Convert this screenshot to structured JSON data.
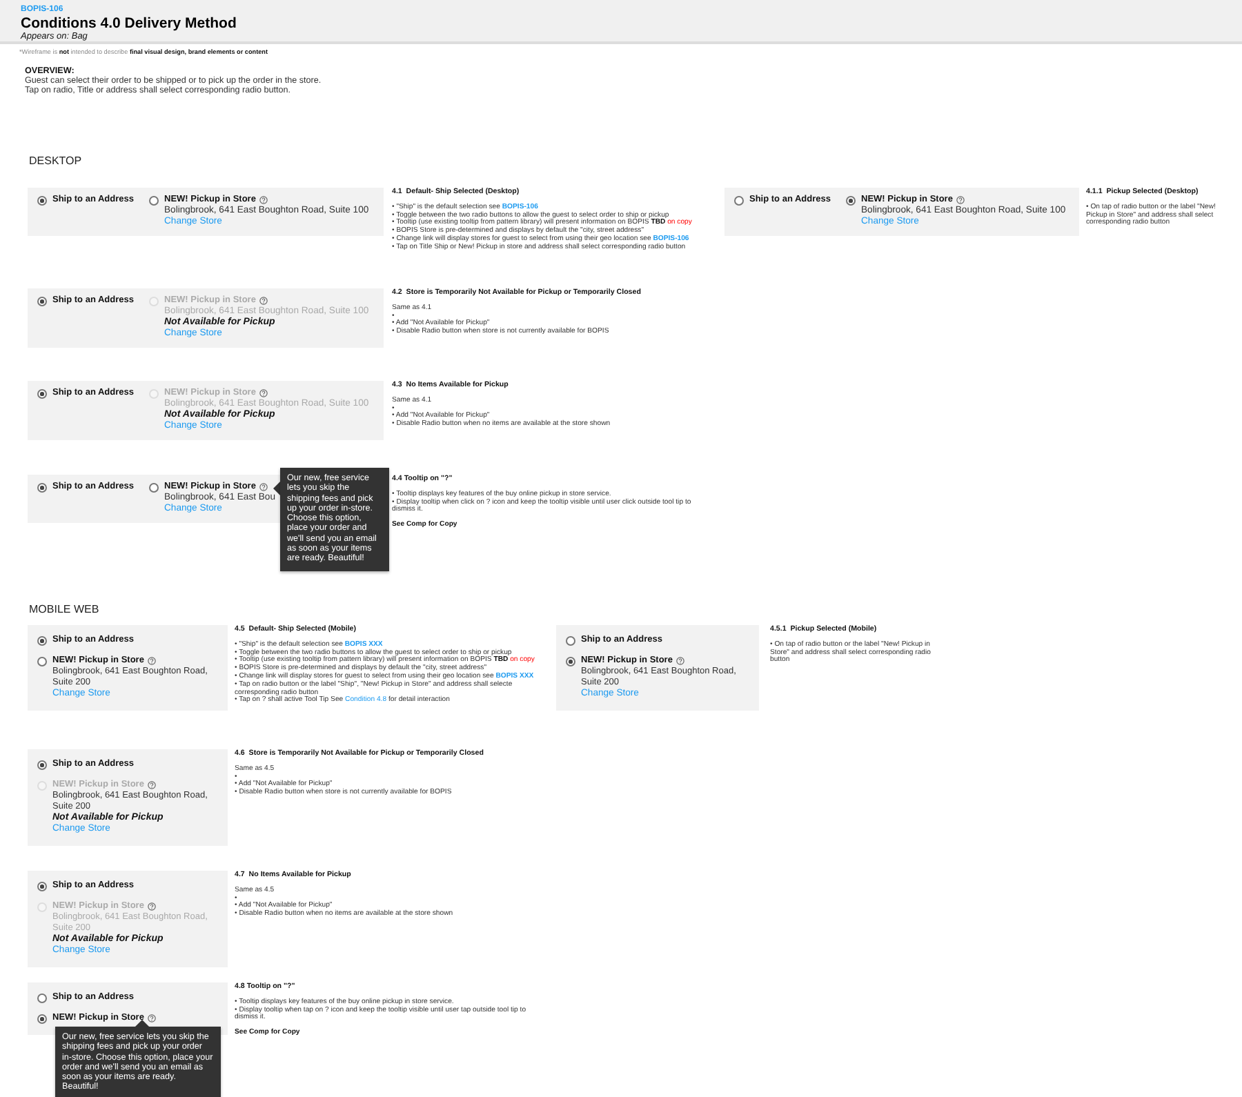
{
  "header": {
    "ticket": "BOPIS-106",
    "title": "Conditions 4.0 Delivery Method",
    "appears_on": "Appears on: Bag"
  },
  "disclaimer": [
    {
      "text": "*Wireframe is ",
      "kind": "muted"
    },
    {
      "text": "not",
      "kind": "alert-strong"
    },
    {
      "text": " intended to describe ",
      "kind": "muted"
    },
    {
      "text": "final visual design, brand elements or content",
      "kind": "strong"
    }
  ],
  "overview": {
    "heading": "OVERVIEW:",
    "lines": [
      "Guest can select their order to be shipped or to pick up the order in the store.",
      "Tap on radio, Title or address shall select corresponding radio button."
    ]
  },
  "sections": [
    {
      "heading": "DESKTOP",
      "kind": "desktop",
      "rows": [
        {
          "items": [
            {
              "kind": "card",
              "ship": {
                "label": "Ship to an Address",
                "selected": true
              },
              "pickup": {
                "label": "NEW! Pickup in Store",
                "selected": false,
                "disabled": false,
                "address": "Bolingbrook, 641 East Boughton Road, Suite 100",
                "address_disabled": false,
                "link": "Change Store"
              }
            },
            {
              "kind": "note",
              "title": "4.1  Default- Ship Selected (Desktop)",
              "lines": [
                {
                  "kind": "text",
                  "parts": [
                    {
                      "text": "• \"Ship\" is the default selection see ",
                      "kind": "plain"
                    },
                    {
                      "text": "BOPIS-106",
                      "kind": "ref"
                    }
                  ]
                },
                {
                  "kind": "text",
                  "parts": [
                    {
                      "text": "• Toggle between the two radio buttons to allow the guest to select order to ship or pickup",
                      "kind": "plain"
                    }
                  ]
                },
                {
                  "kind": "text",
                  "parts": [
                    {
                      "text": "• Tooltip (use existing tooltip from pattern library) will present information on BOPIS ",
                      "kind": "plain"
                    },
                    {
                      "text": "TBD",
                      "kind": "alert-strong"
                    },
                    {
                      "text": " on copy",
                      "kind": "alert"
                    }
                  ]
                },
                {
                  "kind": "text",
                  "parts": [
                    {
                      "text": "• BOPIS Store is pre-determined and displays by default the \"city, street address\"",
                      "kind": "plain"
                    }
                  ]
                },
                {
                  "kind": "text",
                  "parts": [
                    {
                      "text": "• Change link will display stores for guest to select from using their geo location see ",
                      "kind": "plain"
                    },
                    {
                      "text": "BOPIS-106",
                      "kind": "ref"
                    }
                  ]
                },
                {
                  "kind": "text",
                  "parts": [
                    {
                      "text": "• Tap on Title Ship or New! Pickup in store and address shall select corresponding radio button",
                      "kind": "plain"
                    }
                  ]
                }
              ]
            },
            {
              "kind": "card",
              "ship": {
                "label": "Ship to an Address",
                "selected": false
              },
              "pickup": {
                "label": "NEW! Pickup in Store",
                "selected": true,
                "disabled": false,
                "address": "Bolingbrook, 641 East Boughton Road, Suite 100",
                "address_disabled": false,
                "link": "Change Store"
              }
            },
            {
              "kind": "note",
              "title": "4.1.1  Pickup Selected (Desktop)",
              "lines": [
                {
                  "kind": "text",
                  "parts": [
                    {
                      "text": "• On tap of radio button or the label \"New! Pickup in Store\" and address shall select corresponding radio button",
                      "kind": "plain"
                    }
                  ]
                }
              ]
            }
          ]
        },
        {
          "items": [
            {
              "kind": "card",
              "ship": {
                "label": "Ship to an Address",
                "selected": true
              },
              "pickup": {
                "label": "NEW! Pickup in Store",
                "selected": false,
                "disabled": true,
                "address": "Bolingbrook, 641 East Boughton Road, Suite 100",
                "address_disabled": true,
                "unavailable": "Not Available for Pickup",
                "link": "Change Store"
              }
            },
            {
              "kind": "note",
              "title": "4.2  Store is Temporarily Not Available for Pickup or Temporarily Closed",
              "lines": [
                {
                  "kind": "text",
                  "parts": [
                    {
                      "text": "Same as 4.1",
                      "kind": "plain"
                    }
                  ]
                },
                {
                  "kind": "text",
                  "parts": [
                    {
                      "text": "•",
                      "kind": "plain"
                    }
                  ]
                },
                {
                  "kind": "text",
                  "parts": [
                    {
                      "text": "• Add \"Not Available for Pickup\"",
                      "kind": "plain"
                    }
                  ]
                },
                {
                  "kind": "text",
                  "parts": [
                    {
                      "text": "• Disable Radio button when store is not currently available for BOPIS",
                      "kind": "plain"
                    }
                  ]
                }
              ]
            }
          ]
        },
        {
          "items": [
            {
              "kind": "card",
              "ship": {
                "label": "Ship to an Address",
                "selected": true
              },
              "pickup": {
                "label": "NEW! Pickup in Store",
                "selected": false,
                "disabled": true,
                "address": "Bolingbrook, 641 East Boughton Road, Suite 100",
                "address_disabled": true,
                "unavailable": "Not Available for Pickup",
                "link": "Change Store"
              }
            },
            {
              "kind": "note",
              "title": "4.3  No Items Available for Pickup",
              "lines": [
                {
                  "kind": "text",
                  "parts": [
                    {
                      "text": "Same as 4.1",
                      "kind": "plain"
                    }
                  ]
                },
                {
                  "kind": "text",
                  "parts": [
                    {
                      "text": "•",
                      "kind": "plain"
                    }
                  ]
                },
                {
                  "kind": "text",
                  "parts": [
                    {
                      "text": "• Add \"Not Available for Pickup\"",
                      "kind": "plain"
                    }
                  ]
                },
                {
                  "kind": "text",
                  "parts": [
                    {
                      "text": "• Disable Radio button when no items are available at the store shown",
                      "kind": "plain"
                    }
                  ]
                }
              ]
            }
          ]
        },
        {
          "items": [
            {
              "kind": "card",
              "ship": {
                "label": "Ship to an Address",
                "selected": true
              },
              "pickup": {
                "label": "NEW! Pickup in Store",
                "selected": false,
                "disabled": false,
                "address": "Bolingbrook, 641 East Bou",
                "address_disabled": false,
                "link": "Change Store"
              },
              "tooltip": "Our new, free service lets you skip the shipping fees and pick up your order in-store. Choose this option, place your order and we'll send you an email as soon as your items are ready. Beautiful!"
            },
            {
              "kind": "note",
              "title": "4.4 Tooltip on \"?\"",
              "lines": [
                {
                  "kind": "text",
                  "parts": [
                    {
                      "text": "• Tooltip displays key features of the buy online pickup in store service.",
                      "kind": "plain"
                    }
                  ]
                },
                {
                  "kind": "text",
                  "parts": [
                    {
                      "text": "• Display tooltip when click on ? icon and keep the tooltip visible until user click outside tool tip to dismiss it.",
                      "kind": "plain"
                    }
                  ]
                },
                {
                  "kind": "strong",
                  "parts": [
                    {
                      "text": "See Comp for Copy",
                      "kind": "plain"
                    }
                  ]
                }
              ]
            }
          ]
        }
      ]
    },
    {
      "heading": "MOBILE WEB",
      "kind": "mobile",
      "rows": [
        {
          "items": [
            {
              "kind": "card",
              "ship": {
                "label": "Ship to an Address",
                "selected": true
              },
              "pickup": {
                "label": "NEW! Pickup in Store",
                "selected": false,
                "disabled": false,
                "address": "Bolingbrook, 641 East Boughton Road, Suite 200",
                "address_disabled": false,
                "link": "Change Store"
              }
            },
            {
              "kind": "note",
              "title": "4.5  Default- Ship Selected (Mobile)",
              "lines": [
                {
                  "kind": "text",
                  "parts": [
                    {
                      "text": "• \"Ship\" is the default selection see ",
                      "kind": "plain"
                    },
                    {
                      "text": "BOPIS XXX",
                      "kind": "ref"
                    }
                  ]
                },
                {
                  "kind": "text",
                  "parts": [
                    {
                      "text": "• Toggle between the two radio buttons to allow the guest to select order to ship or pickup",
                      "kind": "plain"
                    }
                  ]
                },
                {
                  "kind": "text",
                  "parts": [
                    {
                      "text": "• Tooltip (use existing tooltip from pattern library) will present information on BOPIS ",
                      "kind": "plain"
                    },
                    {
                      "text": "TBD",
                      "kind": "alert-strong"
                    },
                    {
                      "text": " on copy",
                      "kind": "alert"
                    }
                  ]
                },
                {
                  "kind": "text",
                  "parts": [
                    {
                      "text": "• BOPIS Store is pre-determined and displays by default the \"city, street address\"",
                      "kind": "plain"
                    }
                  ]
                },
                {
                  "kind": "text",
                  "parts": [
                    {
                      "text": "• Change link will display stores for guest to select from using their geo location see ",
                      "kind": "plain"
                    },
                    {
                      "text": "BOPIS XXX",
                      "kind": "ref"
                    }
                  ]
                },
                {
                  "kind": "text",
                  "parts": [
                    {
                      "text": "• Tap on radio button or the label \"Ship\", \"New! Pickup in Store\" and address shall selecte corresponding radio button",
                      "kind": "plain"
                    }
                  ]
                },
                {
                  "kind": "text",
                  "parts": [
                    {
                      "text": "• Tap on ? shall active Tool Tip See ",
                      "kind": "plain"
                    },
                    {
                      "text": "Condition 4.8",
                      "kind": "link"
                    },
                    {
                      "text": " for detail interaction",
                      "kind": "plain"
                    }
                  ]
                }
              ]
            },
            {
              "kind": "card",
              "ship": {
                "label": "Ship to an Address",
                "selected": false
              },
              "pickup": {
                "label": "NEW! Pickup in Store",
                "selected": true,
                "disabled": false,
                "address": "Bolingbrook, 641 East Boughton Road, Suite 200",
                "address_disabled": false,
                "link": "Change Store"
              }
            },
            {
              "kind": "note",
              "title": "4.5.1  Pickup Selected (Mobile)",
              "lines": [
                {
                  "kind": "text",
                  "parts": [
                    {
                      "text": "• On tap of radio button or the label \"New! Pickup in Store\" and address shall select corresponding radio button",
                      "kind": "plain"
                    }
                  ]
                }
              ]
            }
          ]
        },
        {
          "items": [
            {
              "kind": "card",
              "ship": {
                "label": "Ship to an Address",
                "selected": true
              },
              "pickup": {
                "label": "NEW! Pickup in Store",
                "selected": false,
                "disabled": true,
                "address": "Bolingbrook, 641 East Boughton Road, Suite 200",
                "address_disabled": false,
                "unavailable": "Not Available for Pickup",
                "link": "Change Store"
              }
            },
            {
              "kind": "note",
              "title": "4.6  Store is Temporarily Not Available for Pickup or Temporarily Closed",
              "lines": [
                {
                  "kind": "text",
                  "parts": [
                    {
                      "text": "Same as 4.5",
                      "kind": "plain"
                    }
                  ]
                },
                {
                  "kind": "text",
                  "parts": [
                    {
                      "text": "•",
                      "kind": "plain"
                    }
                  ]
                },
                {
                  "kind": "text",
                  "parts": [
                    {
                      "text": "• Add \"Not Available for Pickup\"",
                      "kind": "plain"
                    }
                  ]
                },
                {
                  "kind": "text",
                  "parts": [
                    {
                      "text": "• Disable Radio button when store is not currently available for BOPIS",
                      "kind": "plain"
                    }
                  ]
                }
              ]
            }
          ]
        },
        {
          "items": [
            {
              "kind": "card",
              "ship": {
                "label": "Ship to an Address",
                "selected": true
              },
              "pickup": {
                "label": "NEW! Pickup in Store",
                "selected": false,
                "disabled": true,
                "address": "Bolingbrook, 641 East Boughton Road, Suite 200",
                "address_disabled": true,
                "unavailable": "Not Available for Pickup",
                "link": "Change Store"
              }
            },
            {
              "kind": "note",
              "title": "4.7  No Items Available for Pickup",
              "lines": [
                {
                  "kind": "text",
                  "parts": [
                    {
                      "text": "Same as 4.5",
                      "kind": "plain"
                    }
                  ]
                },
                {
                  "kind": "text",
                  "parts": [
                    {
                      "text": "•",
                      "kind": "plain"
                    }
                  ]
                },
                {
                  "kind": "text",
                  "parts": [
                    {
                      "text": "• Add \"Not Available for Pickup\"",
                      "kind": "plain"
                    }
                  ]
                },
                {
                  "kind": "text",
                  "parts": [
                    {
                      "text": "• Disable Radio button when no items are available at the store shown",
                      "kind": "plain"
                    }
                  ]
                }
              ]
            }
          ]
        },
        {
          "items": [
            {
              "kind": "card",
              "ship": {
                "label": "Ship to an Address",
                "selected": false
              },
              "pickup": {
                "label": "NEW! Pickup in Store",
                "selected": true,
                "disabled": false
              },
              "tooltip": "Our new, free service lets you skip the shipping fees and pick up your order in-store. Choose this option, place your order and we'll send you an email as soon as your items are ready. Beautiful!"
            },
            {
              "kind": "note",
              "title": "4.8 Tooltip on \"?\"",
              "lines": [
                {
                  "kind": "text",
                  "parts": [
                    {
                      "text": "• Tooltip displays key features of the buy online pickup in store service.",
                      "kind": "plain"
                    }
                  ]
                },
                {
                  "kind": "text",
                  "parts": [
                    {
                      "text": "• Display tooltip when tap on ? icon and keep the tooltip visible until user tap outside tool tip to dismiss it.",
                      "kind": "plain"
                    }
                  ]
                },
                {
                  "kind": "strong",
                  "parts": [
                    {
                      "text": "See Comp for Copy",
                      "kind": "plain"
                    }
                  ]
                }
              ]
            }
          ]
        }
      ]
    }
  ]
}
